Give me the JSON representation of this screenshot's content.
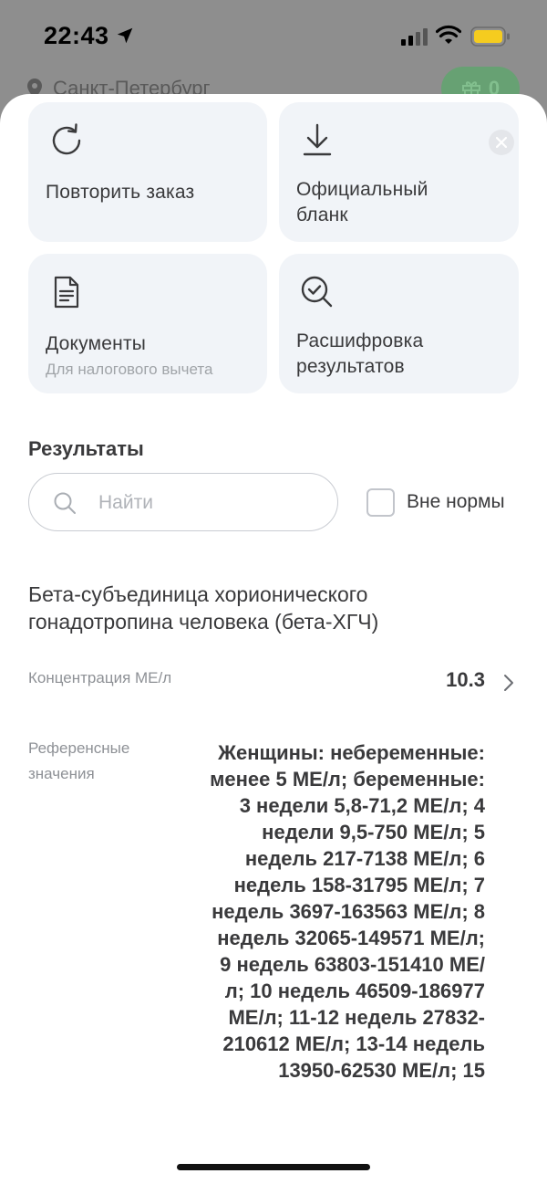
{
  "status": {
    "time": "22:43"
  },
  "header": {
    "city": "Санкт-Петербург",
    "bonus_count": "0"
  },
  "actions": {
    "repeat": {
      "label": "Повторить заказ"
    },
    "blank": {
      "label_line1": "Официальный",
      "label_line2": "бланк"
    },
    "documents": {
      "label": "Документы",
      "sub": "Для налогового вычета"
    },
    "decode": {
      "label_line1": "Расшифровка",
      "label_line2": "результатов"
    }
  },
  "results": {
    "title": "Результаты",
    "search_placeholder": "Найти",
    "out_of_range_label": "Вне нормы",
    "item": {
      "name": "Бета-субъединица хорионического гонадотропина человека (бета-ХГЧ)",
      "concentration_label": "Концентрация МЕ/л",
      "value": "10.3",
      "reference_label": "Референсные значения",
      "reference_text": "Женщины: небеременные: менее 5 МЕ/л; беременные: 3 недели 5,8-71,2 МЕ/л; 4 недели 9,5-750 МЕ/л; 5 недель 217-7138 МЕ/л; 6 недель 158-31795 МЕ/л; 7 недель 3697-163563 МЕ/л; 8 недель 32065-149571 МЕ/л; 9 недель 63803-151410 МЕ/л; 10 недель 46509-186977 МЕ/л; 11-12 недель 27832-210612 МЕ/л; 13-14 недель 13950-62530 МЕ/л; 15"
    }
  },
  "colors": {
    "accent_green": "#5aa86a",
    "card_bg": "#f1f4f8"
  }
}
